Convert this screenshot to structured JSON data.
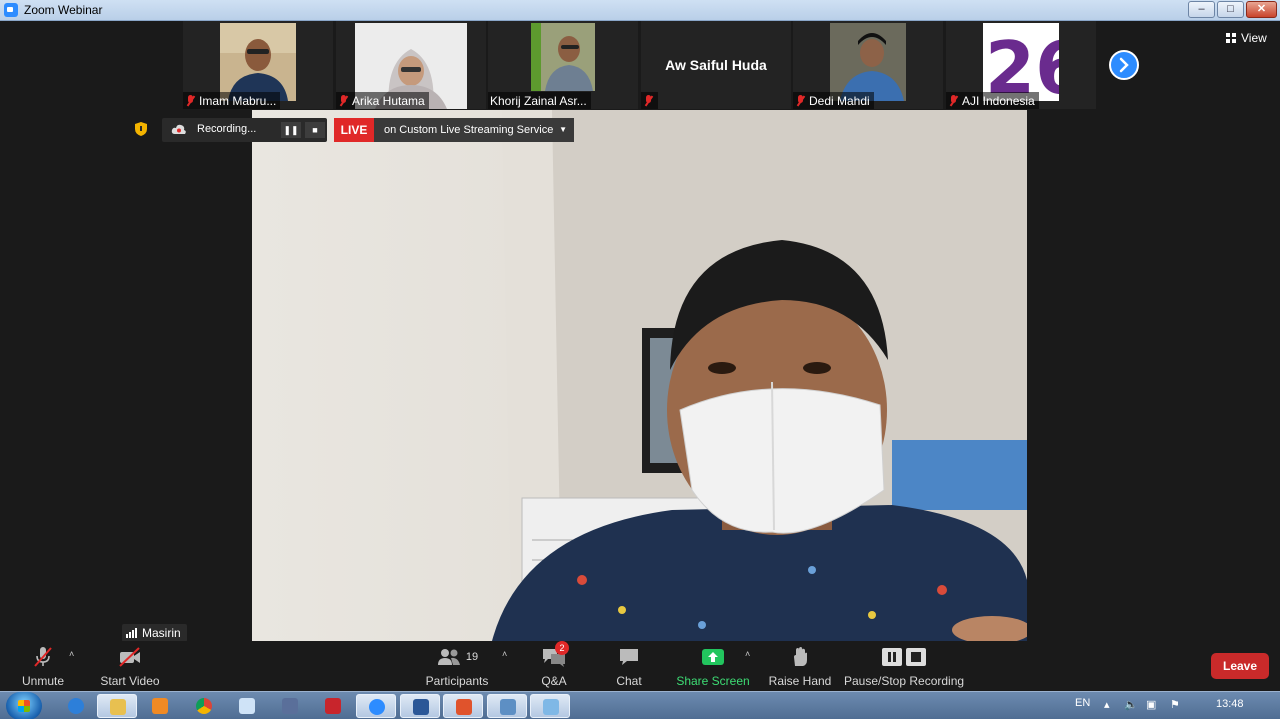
{
  "window": {
    "title": "Zoom Webinar",
    "controls": {
      "minimize": "–",
      "restore": "□",
      "close": "✕"
    }
  },
  "participants_strip": [
    {
      "name": "Imam Mabru...",
      "muted": true,
      "has_video": true
    },
    {
      "name": "Arika Hutama",
      "muted": true,
      "has_video": true
    },
    {
      "name": "Khorij Zainal Asr...",
      "muted": false,
      "has_video": true
    },
    {
      "name": "Aw Saiful Huda",
      "muted": true,
      "has_video": false
    },
    {
      "name": "Dedi Mahdi",
      "muted": true,
      "has_video": true
    },
    {
      "name": "AJI Indonesia",
      "muted": true,
      "has_video": true
    }
  ],
  "view_label": "View",
  "recording": {
    "label": "Recording...",
    "pause": "❚❚",
    "stop": "■"
  },
  "live": {
    "badge": "LIVE",
    "service": "on Custom Live Streaming Service",
    "caret": "▼"
  },
  "active_speaker": "Masirin",
  "toolbar": {
    "unmute": "Unmute",
    "start_video": "Start Video",
    "participants": "Participants",
    "participants_count": "19",
    "qa": "Q&A",
    "qa_badge": "2",
    "chat": "Chat",
    "share_screen": "Share Screen",
    "raise_hand": "Raise Hand",
    "pause_stop_recording": "Pause/Stop Recording",
    "leave": "Leave",
    "caret": "˄"
  },
  "taskbar": {
    "lang": "EN",
    "time": "13:48"
  },
  "colors": {
    "zoom_blue": "#2d8cff",
    "live_red": "#e02828",
    "share_green": "#22c55e",
    "leave_red": "#c92a2a"
  }
}
